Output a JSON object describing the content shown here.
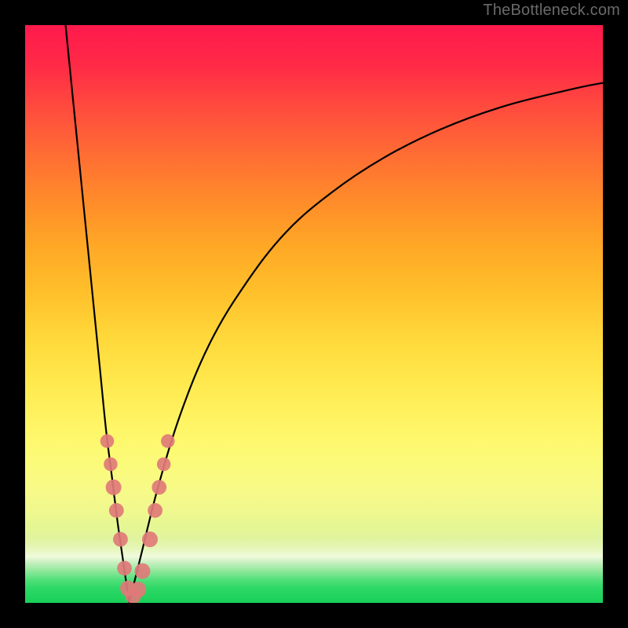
{
  "watermark": "TheBottleneck.com",
  "accent_color": "#e07a78",
  "curve_color": "#000000",
  "chart_data": {
    "type": "line",
    "title": "",
    "xlabel": "",
    "ylabel": "",
    "xlim": [
      0,
      100
    ],
    "ylim": [
      0,
      100
    ],
    "x_optimum": 18,
    "series": [
      {
        "name": "left-branch",
        "x": [
          7,
          8,
          9,
          10,
          11,
          12,
          13,
          14,
          15,
          16,
          17,
          18
        ],
        "y": [
          100,
          90,
          80,
          70,
          60,
          50,
          40,
          30,
          22,
          14,
          7,
          0
        ]
      },
      {
        "name": "right-branch",
        "x": [
          18,
          20,
          23,
          27,
          32,
          38,
          45,
          53,
          62,
          72,
          83,
          95,
          100
        ],
        "y": [
          0,
          8,
          20,
          33,
          45,
          55,
          64,
          71,
          77,
          82,
          86,
          89,
          90
        ]
      }
    ],
    "markers": [
      {
        "x": 14.2,
        "y": 28,
        "r": 1.4
      },
      {
        "x": 14.8,
        "y": 24,
        "r": 1.4
      },
      {
        "x": 15.3,
        "y": 20,
        "r": 1.6
      },
      {
        "x": 15.8,
        "y": 16,
        "r": 1.5
      },
      {
        "x": 16.5,
        "y": 11,
        "r": 1.5
      },
      {
        "x": 17.2,
        "y": 6,
        "r": 1.5
      },
      {
        "x": 17.8,
        "y": 2.5,
        "r": 1.6
      },
      {
        "x": 18.7,
        "y": 1.2,
        "r": 1.6
      },
      {
        "x": 19.6,
        "y": 2.3,
        "r": 1.6
      },
      {
        "x": 20.3,
        "y": 5.5,
        "r": 1.6
      },
      {
        "x": 21.6,
        "y": 11,
        "r": 1.6
      },
      {
        "x": 22.5,
        "y": 16,
        "r": 1.5
      },
      {
        "x": 23.2,
        "y": 20,
        "r": 1.5
      },
      {
        "x": 24.0,
        "y": 24,
        "r": 1.4
      },
      {
        "x": 24.7,
        "y": 28,
        "r": 1.4
      }
    ],
    "gradient_stops": [
      {
        "pos": 0,
        "color": "#ff1a4d"
      },
      {
        "pos": 50,
        "color": "#ffd030"
      },
      {
        "pos": 80,
        "color": "#f8fa86"
      },
      {
        "pos": 92,
        "color": "#f0fadc"
      },
      {
        "pos": 100,
        "color": "#18d058"
      }
    ]
  }
}
